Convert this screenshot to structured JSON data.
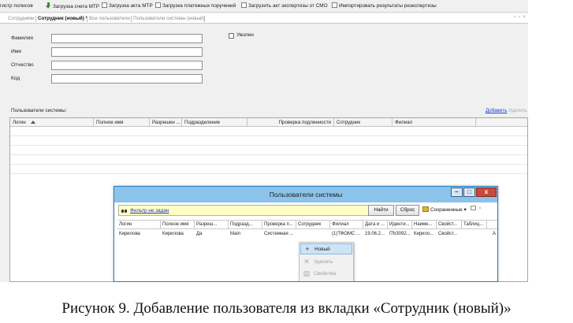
{
  "toolbar": {
    "items": [
      "гистр полисов",
      "Загрузка счета МТР",
      "Загрузка акта МТР",
      "Загрузка платежных поручений",
      "Загрузить акт экспертизы от СМО",
      "Импортировать результаты реэкспертизы"
    ]
  },
  "tabs": {
    "items": [
      "Сотрудники",
      "Сотрудник (новый) *",
      "Все пользователи",
      "Пользователи системы (новый)"
    ],
    "nav": "‹ › ×"
  },
  "form": {
    "last_name_label": "Фамилия",
    "first_name_label": "Имя",
    "middle_name_label": "Отчество",
    "code_label": "Код",
    "last_name_value": "",
    "first_name_value": "",
    "middle_name_value": "",
    "code_value": "",
    "dismissed_label": "Уволен"
  },
  "users_section": {
    "title": "Пользователи системы:",
    "add_label": "Добавить",
    "delete_label": "Удалить",
    "columns": [
      "Логин",
      "Полное имя",
      "Разрешен ...",
      "Подразделение",
      "Проверка подлинности",
      "Сотрудник",
      "Филиал"
    ]
  },
  "dialog": {
    "title": "Пользователи системы",
    "controls": {
      "minimize": "–",
      "maximize": "□",
      "close": "x"
    },
    "filter_label": "Фильтр не задан",
    "find_button": "Найти",
    "reset_button": "Сброс",
    "saved_label": "Сохраненные ▾",
    "saved_tail": "×",
    "columns": [
      "Логин",
      "Полное имя",
      "Разреш...",
      "Подразд...",
      "Проверка п...",
      "Сотрудник",
      "Филиал",
      "Дата и ...",
      "Иденти...",
      "Наиме...",
      "Свойст...",
      "Таблиц..."
    ],
    "rows": [
      [
        "Кирилова",
        "Кирилова",
        "Да",
        "Main",
        "Системная ...",
        "",
        "(1)ТФОМС ...",
        "19.06.2...",
        "f7b3092...",
        "Кирило...",
        "Свойст...",
        "A"
      ]
    ],
    "context_menu": [
      {
        "label": "Новый",
        "icon": "plus-icon",
        "state": "highlighted"
      },
      {
        "label": "Удалить",
        "icon": "x-icon",
        "state": "disabled"
      },
      {
        "label": "Свойства",
        "icon": "properties-icon",
        "state": "disabled"
      }
    ]
  },
  "caption": "Рисунок 9. Добавление пользователя из вкладки «Сотрудник (новый)»"
}
